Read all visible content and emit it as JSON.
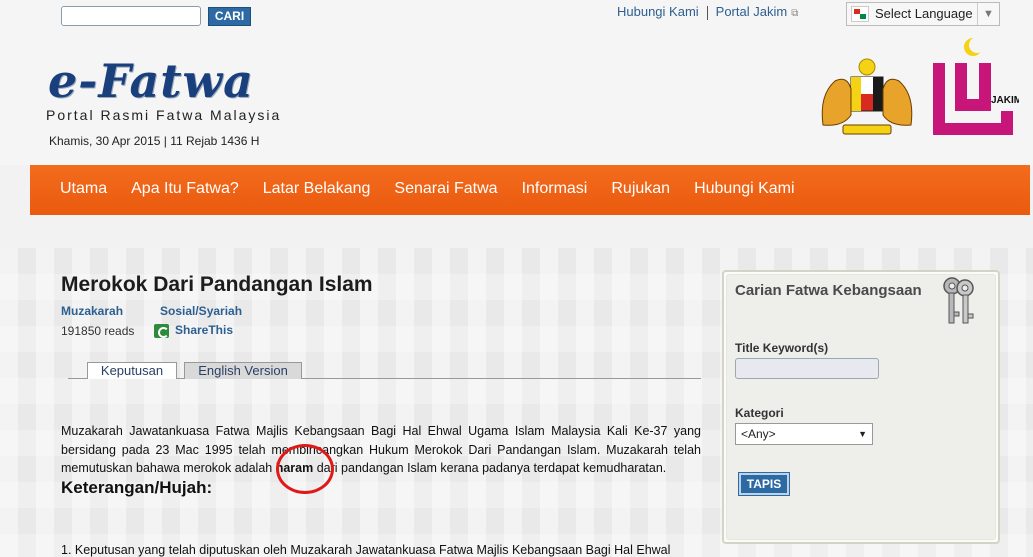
{
  "search": {
    "placeholder": "",
    "button_label": "CARI"
  },
  "top_links": [
    "Hubungi Kami",
    "Portal Jakim"
  ],
  "language": {
    "label": "Select Language"
  },
  "logo": {
    "title": "e-Fatwa",
    "subtitle": "Portal Rasmi Fatwa Malaysia"
  },
  "date_line": "Khamis, 30 Apr 2015 | 11 Rejab 1436 H",
  "jakim_label": "JAKIM",
  "nav": [
    "Utama",
    "Apa Itu Fatwa?",
    "Latar Belakang",
    "Senarai Fatwa",
    "Informasi",
    "Rujukan",
    "Hubungi Kami"
  ],
  "article": {
    "title": "Merokok Dari Pandangan Islam",
    "category": "Muzakarah",
    "subcategory": "Sosial/Syariah",
    "reads": "191850 reads",
    "share": "ShareThis",
    "tabs": [
      "Keputusan",
      "English Version"
    ],
    "para_part1": "Muzakarah Jawatankuasa Fatwa Majlis Kebangsaan Bagi Hal Ehwal Ugama Islam Malaysia Kali Ke-37 yang bersidang pada 23 Mac 1995 telah membincangkan Hukum Merokok Dari Pandangan Islam. Muzakarah telah memutuskan bahawa merokok adalah ",
    "para_bold": "haram",
    "para_part2": " dari pandangan Islam kerana padanya terdapat kemudharatan.",
    "heading": "Keterangan/Hujah:",
    "list_item_1": "1.  Keputusan yang telah diputuskan oleh Muzakarah Jawatankuasa Fatwa Majlis Kebangsaan Bagi Hal Ehwal"
  },
  "sidebar": {
    "title": "Carian Fatwa Kebangsaan",
    "keyword_label": "Title Keyword(s)",
    "category_label": "Kategori",
    "category_value": "<Any>",
    "submit_label": "TAPIS"
  }
}
